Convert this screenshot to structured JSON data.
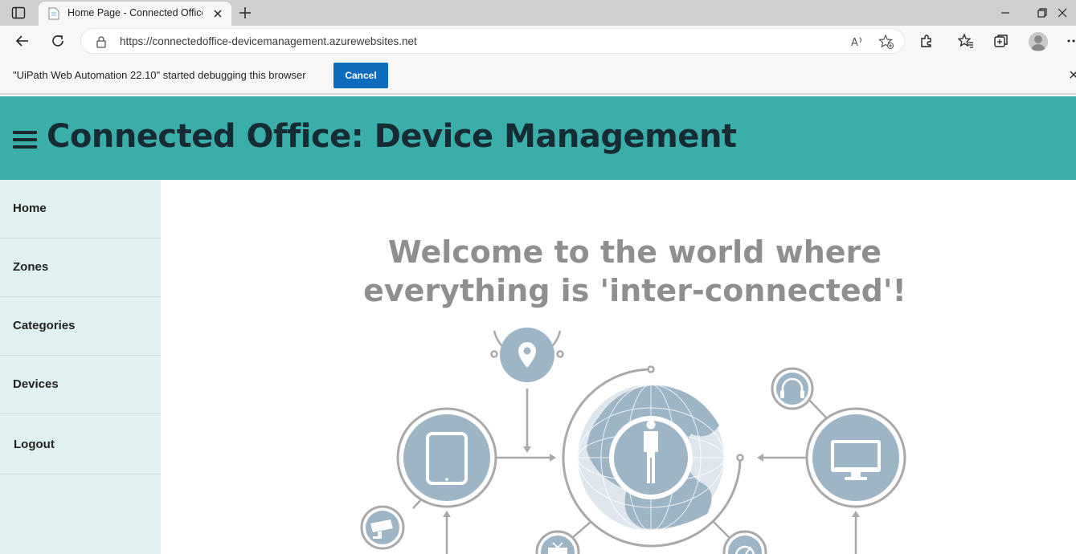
{
  "browser": {
    "tab_title": "Home Page - Connected Office: Device Management",
    "url": "https://connectedoffice-devicemanagement.azurewebsites.net",
    "icons": [
      "tab-actions-icon",
      "page-icon",
      "close-icon",
      "plus-icon",
      "minimize-icon",
      "restore-icon",
      "window-close-icon",
      "back-arrow-icon",
      "refresh-icon",
      "lock-icon",
      "read-aloud-icon",
      "add-favorite-icon",
      "extensions-icon",
      "favorites-icon",
      "collections-icon",
      "profile-avatar",
      "more-icon"
    ]
  },
  "infobar": {
    "message": "\"UiPath Web Automation 22.10\" started debugging this browser",
    "cancel_label": "Cancel"
  },
  "header": {
    "title": "Connected Office: Device Management",
    "background": "#3aaea9"
  },
  "sidebar": {
    "items": [
      {
        "label": "Home"
      },
      {
        "label": "Zones"
      },
      {
        "label": "Categories"
      },
      {
        "label": "Devices"
      },
      {
        "label": "Logout"
      }
    ],
    "background": "#dff1f0"
  },
  "main": {
    "welcome_line1": "Welcome to the world where",
    "welcome_line2": "everything is 'inter-connected'!",
    "hero_icons": [
      "location-pin-icon",
      "tablet-icon",
      "globe-person-icon",
      "headphones-icon",
      "monitor-icon",
      "cctv-camera-icon",
      "tv-icon",
      "gauge-icon"
    ]
  }
}
